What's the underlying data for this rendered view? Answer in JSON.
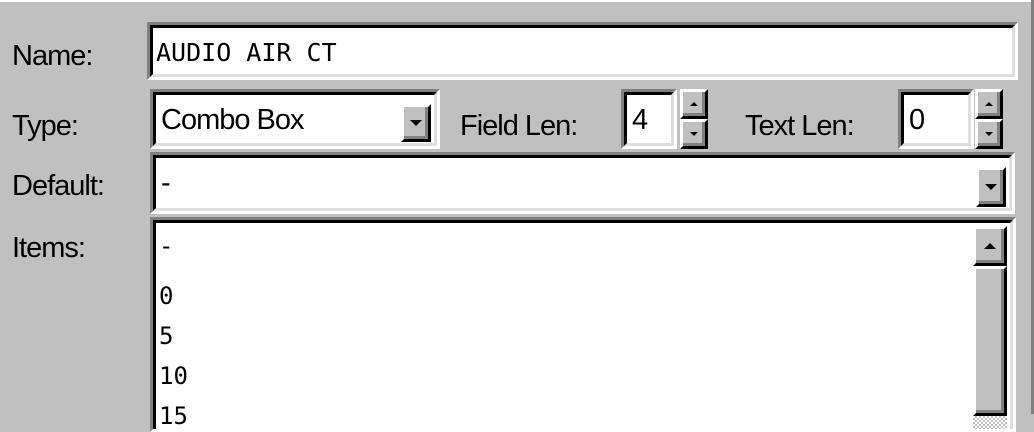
{
  "form": {
    "name_label": "Name:",
    "name_value": "AUDIO AIR CT",
    "type_label": "Type:",
    "type_value": "Combo Box",
    "field_len_label": "Field Len:",
    "field_len_value": "4",
    "text_len_label": "Text Len:",
    "text_len_value": "0",
    "default_label": "Default:",
    "default_value": "-",
    "items_label": "Items:",
    "items": [
      "-",
      "0",
      "5",
      "10",
      "15"
    ]
  }
}
